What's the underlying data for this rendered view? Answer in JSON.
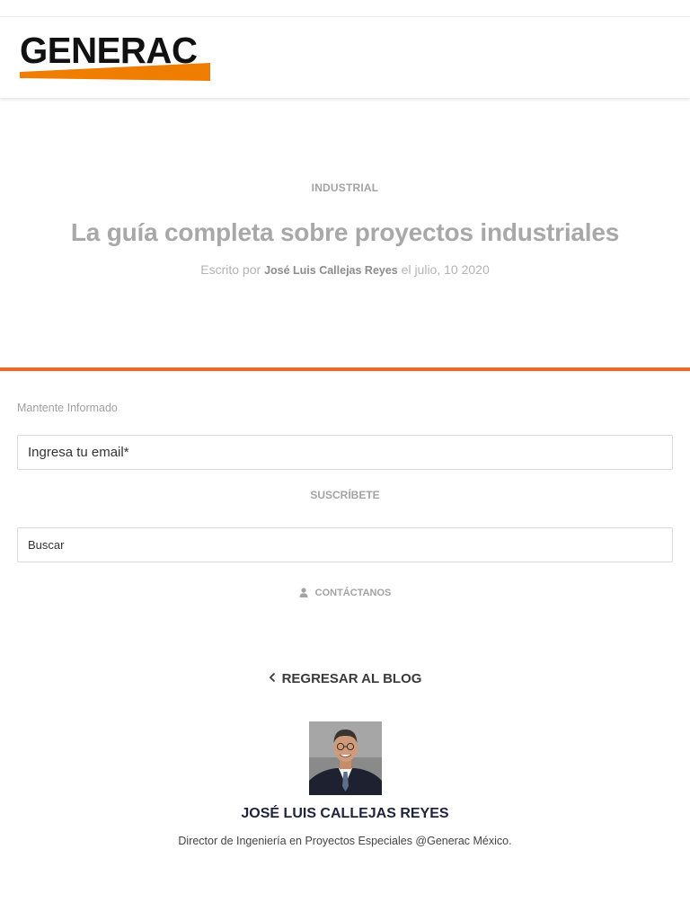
{
  "brand": {
    "logo_text": "GENERAC",
    "accent_color": "#f26522",
    "logo_swoosh_color": "#ef7d00"
  },
  "post": {
    "category": "INDUSTRIAL",
    "title": "La guía completa sobre proyectos industriales",
    "byline_prefix": "Escrito por",
    "author": "José Luis Callejas Reyes",
    "date": "el julio, 10 2020"
  },
  "subscribe": {
    "heading": "Mantente Informado",
    "email_placeholder": "Ingresa tu email*",
    "button_label": "SUSCRÍBETE"
  },
  "search": {
    "placeholder": "Buscar"
  },
  "contact": {
    "icon": "user-icon",
    "label": "CONTÁCTANOS"
  },
  "back": {
    "icon": "chevron-left-icon",
    "label": "REGRESAR AL BLOG"
  },
  "author_card": {
    "name": "JOSÉ LUIS CALLEJAS REYES",
    "bio": "Director de Ingeniería en Proyectos Especiales @Generac México."
  }
}
